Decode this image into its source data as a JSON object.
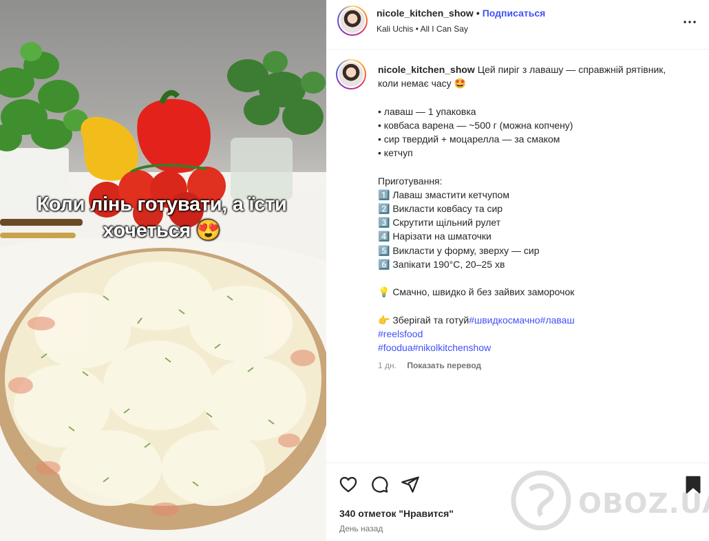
{
  "post": {
    "video_overlay_text": "Коли лінь готувати, а їсти хочеться 😍",
    "header": {
      "username": "nicole_kitchen_show",
      "separator": "•",
      "follow_label": "Подписаться",
      "audio_artist": "Kali Uchis",
      "audio_separator": "•",
      "audio_title": "All I Can Say",
      "more_icon": "more-horizontal-icon"
    },
    "caption": {
      "username": "nicole_kitchen_show",
      "intro": "Цей пиріг з лавашу — справжній рятівник, коли немає часу 🤩",
      "ingredients": [
        "• лаваш — 1 упаковка",
        "• ковбаса варена — ~500 г (можна копчену)",
        "• сир твердий + моцарелла — за смаком",
        "• кетчуп"
      ],
      "steps_title": "Приготування:",
      "steps": [
        "1️⃣ Лаваш змастити кетчупом",
        "2️⃣ Викласти ковбасу та сир",
        "3️⃣ Скрутити щільний рулет",
        "4️⃣ Нарізати на шматочки",
        "5️⃣ Викласти у форму, зверху — сир",
        "6️⃣ Запікати 190°C, 20–25 хв"
      ],
      "tip": "💡 Смачно, швидко й без зайвих заморочок",
      "cta": "👉 Зберігай та готуй",
      "hashtags_line1": [
        "#швидкосмачно",
        "#лаваш"
      ],
      "hashtags_line2": [
        "#reelsfood"
      ],
      "hashtags_line3": [
        "#foodua",
        "#nikolkitchenshow"
      ]
    },
    "meta": {
      "age": "1 дн.",
      "translate_label": "Показать перевод"
    },
    "actions": {
      "like_icon": "heart-icon",
      "comment_icon": "comment-icon",
      "share_icon": "share-icon",
      "save_icon": "bookmark-icon",
      "likes_text": "340 отметок \"Нравится\"",
      "timestamp": "День назад"
    },
    "watermark": "OBOZ.UA",
    "colors": {
      "link": "#4150f7",
      "text": "#262626",
      "muted": "#737373",
      "border": "#efefef"
    }
  }
}
